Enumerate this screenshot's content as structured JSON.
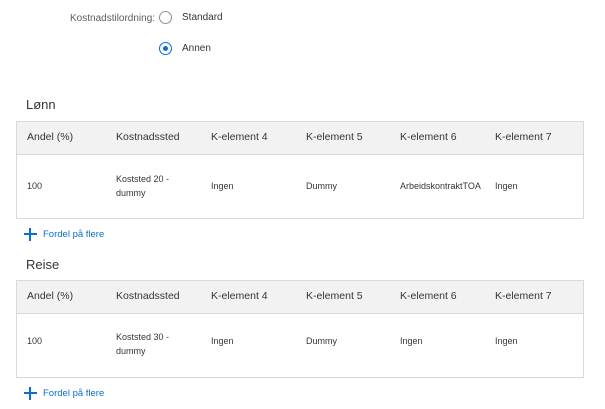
{
  "cost_allocation": {
    "label": "Kostnadstilordning:",
    "options": [
      {
        "label": "Standard",
        "selected": false
      },
      {
        "label": "Annen",
        "selected": true
      }
    ]
  },
  "columns": [
    "Andel (%)",
    "Kostnadssted",
    "K-element 4",
    "K-element 5",
    "K-element 6",
    "K-element 7"
  ],
  "sections": [
    {
      "title": "Lønn",
      "rows": [
        {
          "share": "100",
          "cost_center": "Koststed 20 - dummy",
          "k4": "Ingen",
          "k5": "Dummy",
          "k6": "ArbeidskontraktTOA",
          "k7": "Ingen"
        }
      ],
      "add_link": "Fordel på flere"
    },
    {
      "title": "Reise",
      "rows": [
        {
          "share": "100",
          "cost_center": "Koststed 30 - dummy",
          "k4": "Ingen",
          "k5": "Dummy",
          "k6": "Ingen",
          "k7": "Ingen"
        }
      ],
      "add_link": "Fordel på flere"
    }
  ],
  "colors": {
    "accent": "#0a6ed1",
    "header_bg": "#f2f2f2",
    "border": "#d9d9d9"
  },
  "icons": {
    "add": "plus-icon"
  }
}
